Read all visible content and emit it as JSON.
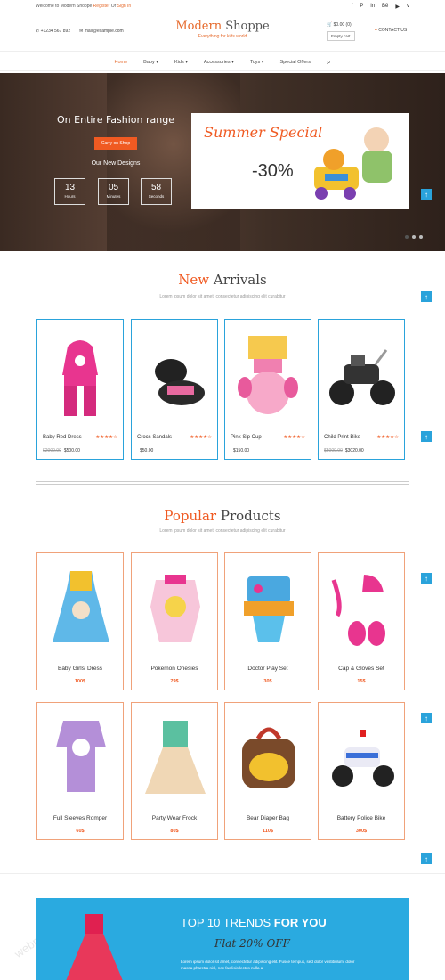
{
  "topbar": {
    "welcome": "Welcome to Modern Shoppe",
    "register": "Register",
    "or": "Or",
    "signin": "Sign In"
  },
  "header": {
    "phone": "+1234 567 892",
    "email": "mail@example.com",
    "logo_a": "Modern",
    "logo_b": "Shoppe",
    "tagline": "Everything for kids world",
    "cart_total": "$0.00 (0)",
    "empty_cart": "Empty cart",
    "contact": "CONTACT US"
  },
  "nav": {
    "home": "Home",
    "baby": "Baby ▾",
    "kids": "Kids ▾",
    "accessories": "Accessories ▾",
    "toys": "Toys ▾",
    "offers": "Special Offers"
  },
  "hero": {
    "title": "On Entire Fashion range",
    "button": "Carry on Shop",
    "subtitle": "Our New Designs",
    "countdown": [
      {
        "n": "13",
        "l": "Hours"
      },
      {
        "n": "05",
        "l": "Minutes"
      },
      {
        "n": "58",
        "l": "Seconds"
      }
    ],
    "slide_title": "Summer Special",
    "slide_pct": "-30%"
  },
  "arrivals": {
    "title_a": "New",
    "title_b": "Arrivals",
    "subtitle": "Lorem ipsum dolor sit amet, consectetur adipiscing elit curabitur",
    "items": [
      {
        "name": "Baby Red Dress",
        "old": "$2000.00",
        "price": "$500.00",
        "stars": "★★★★☆"
      },
      {
        "name": "Crocs Sandals",
        "old": "",
        "price": "$50.00",
        "stars": "★★★★☆"
      },
      {
        "name": "Pink Sip Cup",
        "old": "",
        "price": "$150.00",
        "stars": "★★★★☆"
      },
      {
        "name": "Child Print Bike",
        "old": "$5000.00",
        "price": "$3020.00",
        "stars": "★★★★☆"
      }
    ]
  },
  "popular": {
    "title_a": "Popular",
    "title_b": "Products",
    "subtitle": "Lorem ipsum dolor sit amet, consectetur adipiscing elit curabitur",
    "items": [
      {
        "name": "Baby Girls' Dress",
        "price": "100$"
      },
      {
        "name": "Pokemon Onesies",
        "price": "79$"
      },
      {
        "name": "Doctor Play Set",
        "price": "30$"
      },
      {
        "name": "Cap & Gloves Set",
        "price": "15$"
      },
      {
        "name": "Full Sleeves Romper",
        "price": "60$"
      },
      {
        "name": "Party Wear Frock",
        "price": "80$"
      },
      {
        "name": "Bear Diaper Bag",
        "price": "110$"
      },
      {
        "name": "Battery Police Bike",
        "price": "300$"
      }
    ]
  },
  "banner": {
    "title_a": "TOP 10 TRENDS",
    "title_b": "FOR YOU",
    "offer": "Flat 20% OFF",
    "desc": "Lorem ipsum dolor sit amet, consectetur adipiscing elit. Fusce tempus, sed dolor vestibulum, dolor massa pharetra nisl, nec facilisis lectus nulla a"
  },
  "watermark": "webmoban.net",
  "colors": {
    "accent": "#f05a22",
    "blue": "#2aa3db"
  }
}
